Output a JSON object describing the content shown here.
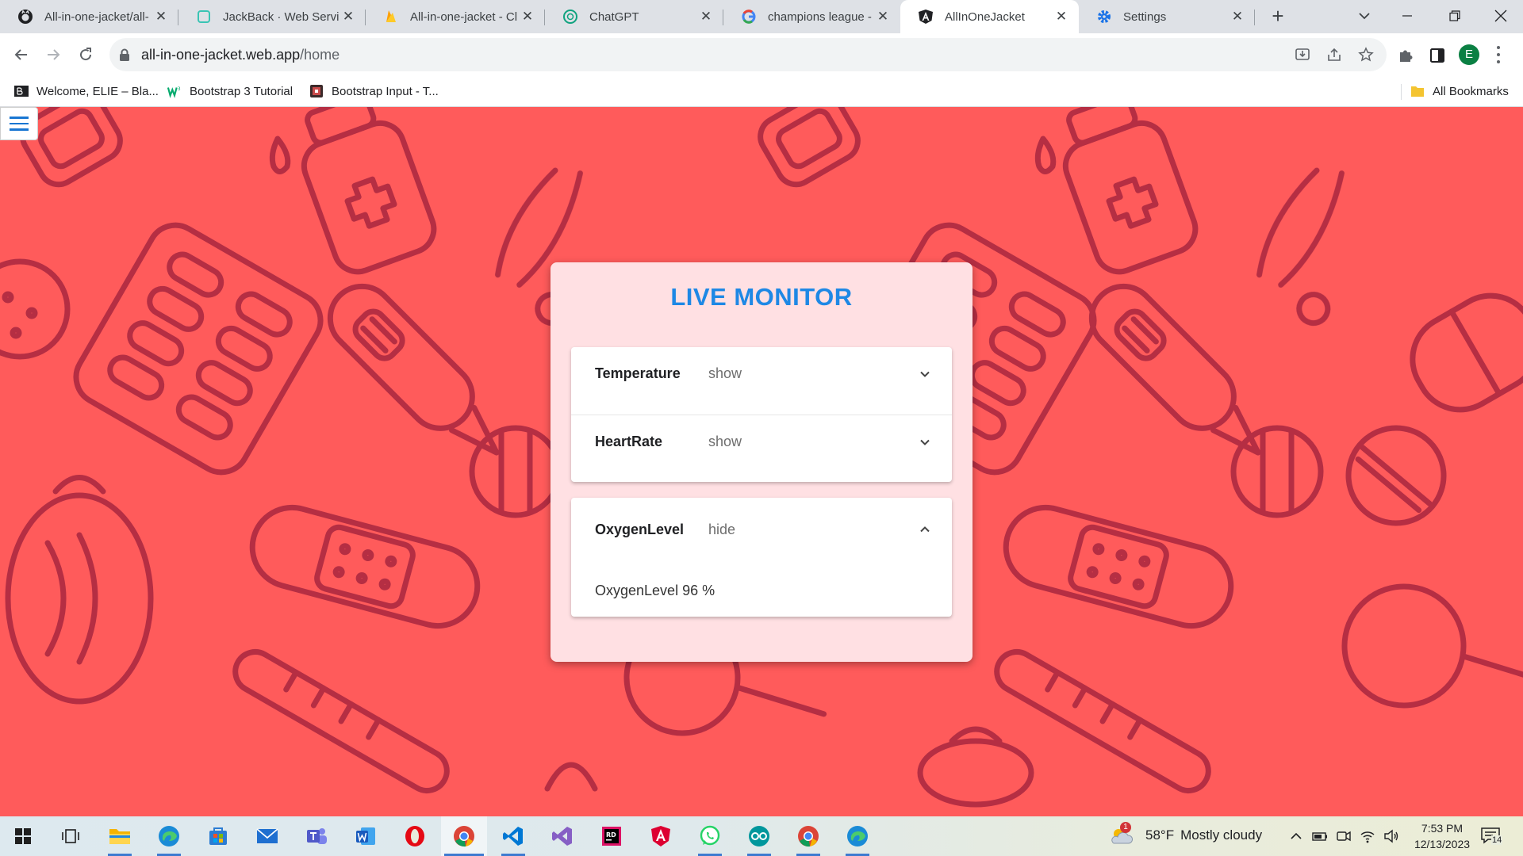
{
  "browser": {
    "tabs": [
      {
        "label": "All-in-one-jacket/all-",
        "icon": "github-icon"
      },
      {
        "label": "JackBack · Web Servi",
        "icon": "jackback-icon"
      },
      {
        "label": "All-in-one-jacket - Cl",
        "icon": "firebase-icon"
      },
      {
        "label": "ChatGPT",
        "icon": "chatgpt-icon"
      },
      {
        "label": "champions league - G",
        "icon": "google-icon"
      },
      {
        "label": "AllInOneJacket",
        "icon": "angular-icon"
      },
      {
        "label": "Settings",
        "icon": "gear-icon"
      }
    ],
    "active_tab_index": 5,
    "url": {
      "host": "all-in-one-jacket.web.app",
      "path": "/home"
    },
    "profile_initial": "E",
    "bookmarks": [
      {
        "label": "Welcome, ELIE – Bla...",
        "icon": "blackboard-icon"
      },
      {
        "label": "Bootstrap 3 Tutorial",
        "icon": "w3schools-icon"
      },
      {
        "label": "Bootstrap Input - T...",
        "icon": "bookmark-site-icon"
      }
    ],
    "all_bookmarks_label": "All Bookmarks"
  },
  "page": {
    "title": "LIVE MONITOR",
    "panels": [
      {
        "title": "Temperature",
        "description": "show",
        "expanded": false
      },
      {
        "title": "HeartRate",
        "description": "show",
        "expanded": false
      },
      {
        "title": "OxygenLevel",
        "description": "hide",
        "expanded": true,
        "body": {
          "label": "OxygenLevel",
          "value": "96",
          "unit": "%"
        }
      }
    ],
    "colors": {
      "background": "#ff5b5b",
      "pattern": "#a8263f",
      "card": "#ffe0e3",
      "title": "#1e88e5"
    }
  },
  "taskbar": {
    "apps": [
      "windows-start-icon",
      "task-view-icon",
      "file-explorer-icon",
      "edge-icon",
      "microsoft-store-icon",
      "mail-icon",
      "teams-icon",
      "word-icon",
      "opera-icon",
      "chrome-icon",
      "vscode-icon",
      "visual-studio-icon",
      "rider-icon",
      "angular-icon",
      "whatsapp-icon",
      "arduino-icon",
      "chrome-icon",
      "edge-icon"
    ],
    "active_app_index": 9,
    "weather": {
      "temperature": "58°F",
      "condition": "Mostly cloudy",
      "alert_count": "1"
    },
    "clock": {
      "time": "7:53 PM",
      "date": "12/13/2023"
    },
    "notification_count": "14"
  }
}
